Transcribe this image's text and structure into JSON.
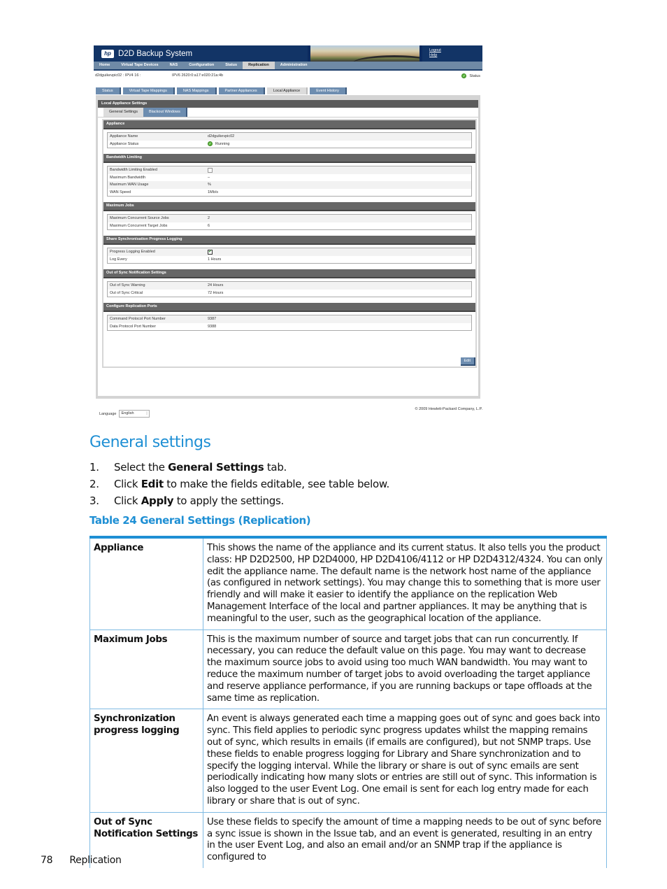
{
  "ui_screenshot": {
    "app_title": "D2D Backup System",
    "header_links": [
      "Logout",
      "Help"
    ],
    "nav": [
      {
        "label": "Home",
        "active": false
      },
      {
        "label": "Virtual Tape Devices",
        "active": false
      },
      {
        "label": "NAS",
        "active": false
      },
      {
        "label": "Configuration",
        "active": false
      },
      {
        "label": "Status",
        "active": false
      },
      {
        "label": "Replication",
        "active": true
      },
      {
        "label": "Administration",
        "active": false
      }
    ],
    "host_info": "d2dguikevpic02 : IPV4 16 :",
    "ipv6_info": "IPV6 2620:0:a17:e020:21a:4b",
    "status_label": "Status",
    "subtabs": [
      {
        "label": "Status",
        "active": false
      },
      {
        "label": "Virtual Tape Mappings",
        "active": false
      },
      {
        "label": "NAS Mappings",
        "active": false
      },
      {
        "label": "Partner Appliances",
        "active": false
      },
      {
        "label": "Local Appliance",
        "active": true
      },
      {
        "label": "Event History",
        "active": false
      }
    ],
    "panel_title": "Local Appliance Settings",
    "inner_tabs": [
      {
        "label": "General Settings",
        "active": true
      },
      {
        "label": "Blackout Windows",
        "active": false
      }
    ],
    "sections": [
      {
        "title": "Appliance",
        "rows": [
          {
            "key": "Appliance Name",
            "value": "d2dguikevpic02"
          },
          {
            "key": "Appliance Status",
            "value": "Running",
            "icon": "ok"
          }
        ]
      },
      {
        "title": "Bandwidth Limiting",
        "rows": [
          {
            "key": "Bandwidth Limiting Enabled",
            "checkbox": false
          },
          {
            "key": "Maximum Bandwidth",
            "value": "–"
          },
          {
            "key": "Maximum WAN Usage",
            "value": "%"
          },
          {
            "key": "WAN Speed",
            "value": "1Mb/s"
          }
        ]
      },
      {
        "title": "Maximum Jobs",
        "rows": [
          {
            "key": "Maximum Concurrent Source Jobs",
            "value": "2"
          },
          {
            "key": "Maximum Concurrent Target Jobs",
            "value": "6"
          }
        ]
      },
      {
        "title": "Share Synchronisation Progress Logging",
        "rows": [
          {
            "key": "Progress Logging Enabled",
            "checkbox": true
          },
          {
            "key": "Log Every",
            "value": "1 Hours"
          }
        ]
      },
      {
        "title": "Out of Sync Notification Settings",
        "rows": [
          {
            "key": "Out of Sync Warning",
            "value": "24 Hours"
          },
          {
            "key": "Out of Sync Critical",
            "value": "72 Hours"
          }
        ]
      },
      {
        "title": "Configure Replication Ports",
        "rows": [
          {
            "key": "Command Protocol Port Number",
            "value": "9387"
          },
          {
            "key": "Data Protocol Port Number",
            "value": "9388"
          }
        ]
      }
    ],
    "edit_button": "Edit",
    "language_label": "Language",
    "language_value": "English",
    "copyright": "© 2009 Hewlett-Packard Company, L.P."
  },
  "document": {
    "section_heading": "General settings",
    "steps": [
      {
        "num": "1.",
        "pre": "Select the ",
        "bold": "General Settings",
        "post": " tab."
      },
      {
        "num": "2.",
        "pre": "Click ",
        "bold": "Edit",
        "post": " to make the fields editable, see table below."
      },
      {
        "num": "3.",
        "pre": "Click ",
        "bold": "Apply",
        "post": " to apply the settings."
      }
    ],
    "table_caption": "Table 24 General Settings (Replication)",
    "table_rows": [
      {
        "term": "Appliance",
        "desc": "This shows the name of the appliance and its current status. It also tells you the product class: HP D2D2500, HP D2D4000, HP D2D4106/4112 or HP D2D4312/4324. You can only edit the appliance name. The default name is the network host name of the appliance (as configured in network settings). You may change this to something that is more user friendly and will make it easier to identify the appliance on the replication Web Management Interface of the local and partner appliances. It may be anything that is meaningful to the user, such as the geographical location of the appliance."
      },
      {
        "term": "Maximum Jobs",
        "desc": "This is the maximum number of source and target jobs that can run concurrently. If necessary, you can reduce the default value on this page. You may want to decrease the maximum source jobs to avoid using too much WAN bandwidth. You may want to reduce the maximum number of target jobs to avoid overloading the target appliance and reserve appliance performance, if you are running backups or tape offloads at the same time as replication."
      },
      {
        "term": "Synchronization progress logging",
        "desc": "An event is always generated each time a mapping goes out of sync and goes back into sync. This field applies to periodic sync progress updates whilst the mapping remains out of sync, which results in emails (if emails are configured), but not SNMP traps. Use these fields to enable progress logging for Library and Share synchronization and to specify the logging interval. While the library or share is out of sync emails are sent periodically indicating how many slots or entries are still out of sync. This information is also logged to the user Event Log. One email is sent for each log entry made for each library or share that is out of sync."
      },
      {
        "term": "Out of Sync Notification Settings",
        "desc": "Use these fields to specify the amount of time a mapping needs to be out of sync before a sync issue is shown in the Issue tab, and an event is generated, resulting in an entry in the user Event Log, and also an email and/or an SNMP trap if the appliance is configured to"
      }
    ],
    "page_number": "78",
    "page_section": "Replication"
  }
}
